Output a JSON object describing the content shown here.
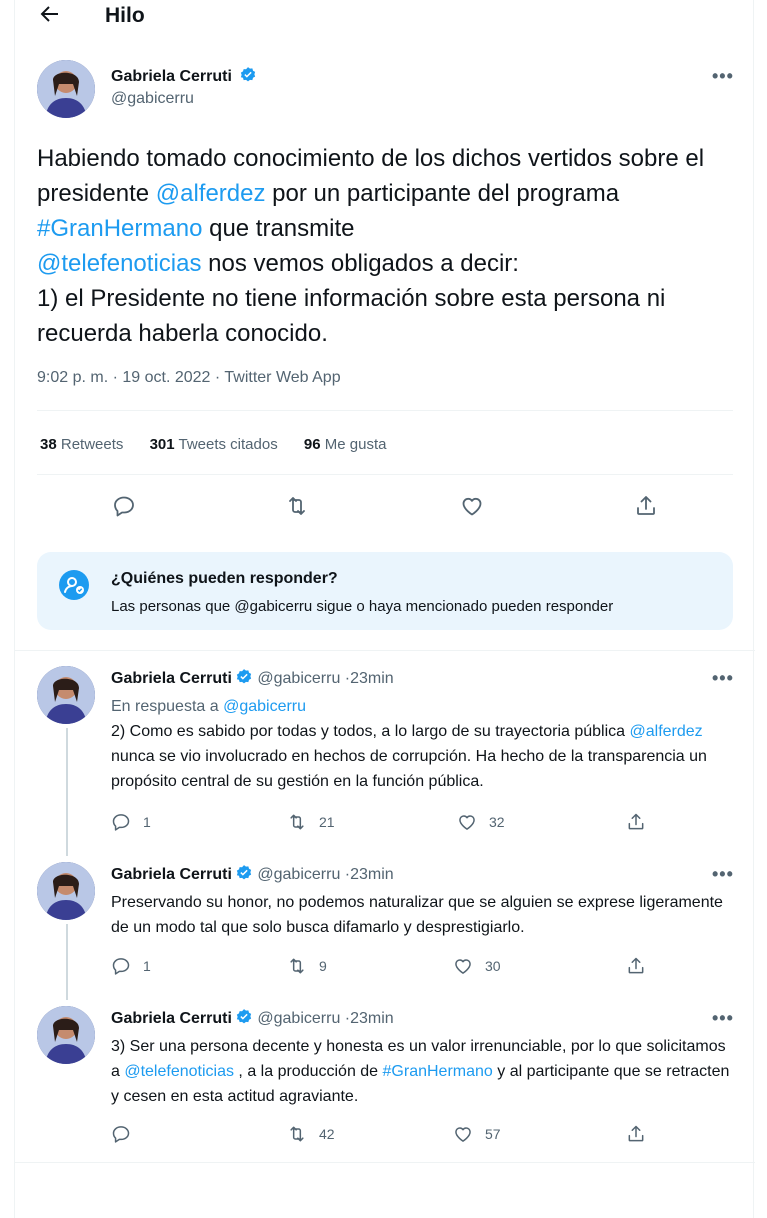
{
  "header": {
    "title": "Hilo"
  },
  "main_tweet": {
    "author_name": "Gabriela Cerruti",
    "handle": "@gabicerru",
    "text_parts": {
      "p1": "Habiendo tomado conocimiento de los dichos vertidos sobre el presidente ",
      "m1": "@alferdez",
      "p2": "  por un participante del programa ",
      "h1": "#GranHermano",
      "p3": " que transmite ",
      "m2": "@telefenoticias",
      "p4": " nos vemos obligados a decir:",
      "p5": "1) el Presidente no tiene información sobre esta persona ni recuerda haberla conocido."
    },
    "time": "9:02 p. m.",
    "date": "19 oct. 2022",
    "source": "Twitter Web App",
    "retweets_count": "38",
    "retweets_label": "Retweets",
    "quotes_count": "301",
    "quotes_label": "Tweets citados",
    "likes_count": "96",
    "likes_label": "Me gusta"
  },
  "who_can_reply": {
    "title": "¿Quiénes pueden responder?",
    "subtitle": "Las personas que @gabicerru sigue o haya mencionado pueden responder"
  },
  "replies": [
    {
      "author_name": "Gabriela Cerruti",
      "handle": "@gabicerru",
      "dot": "·",
      "time": "23min",
      "reply_to_label": "En respuesta a ",
      "reply_to_handle": "@gabicerru",
      "text_a": "2) Como es sabido por todas y todos, a lo largo de su trayectoria pública ",
      "mention": "@alferdez",
      "text_b": "  nunca se vio involucrado en hechos de corrupción. Ha hecho de la transparencia un propósito central de su gestión en la función pública.",
      "replies": "1",
      "retweets": "21",
      "likes": "32"
    },
    {
      "author_name": "Gabriela Cerruti",
      "handle": "@gabicerru",
      "dot": "·",
      "time": "23min",
      "text": "Preservando su honor, no podemos naturalizar que se alguien se exprese ligeramente de un modo tal que solo busca difamarlo y desprestigiarlo.",
      "replies": "1",
      "retweets": "9",
      "likes": "30"
    },
    {
      "author_name": "Gabriela Cerruti",
      "handle": "@gabicerru",
      "dot": "·",
      "time": "23min",
      "text_a": "3) Ser una persona decente y honesta es un valor irrenunciable, por lo que solicitamos a ",
      "mention": "@telefenoticias",
      "text_b": " , a la producción de ",
      "hashtag": "#GranHermano",
      "text_c": " y al participante que se retracten y cesen en esta actitud agraviante.",
      "replies": "",
      "retweets": "42",
      "likes": "57"
    }
  ],
  "icons": {
    "back": "arrow-left-icon",
    "more": "more-horizontal-icon",
    "verified": "verified-badge-icon",
    "reply": "reply-icon",
    "retweet": "retweet-icon",
    "like": "heart-icon",
    "share": "share-icon",
    "who": "at-mention-icon"
  },
  "colors": {
    "accent": "#1d9bf0",
    "text": "#0f1419",
    "muted": "#536471",
    "info_bg": "#eaf5fd"
  }
}
